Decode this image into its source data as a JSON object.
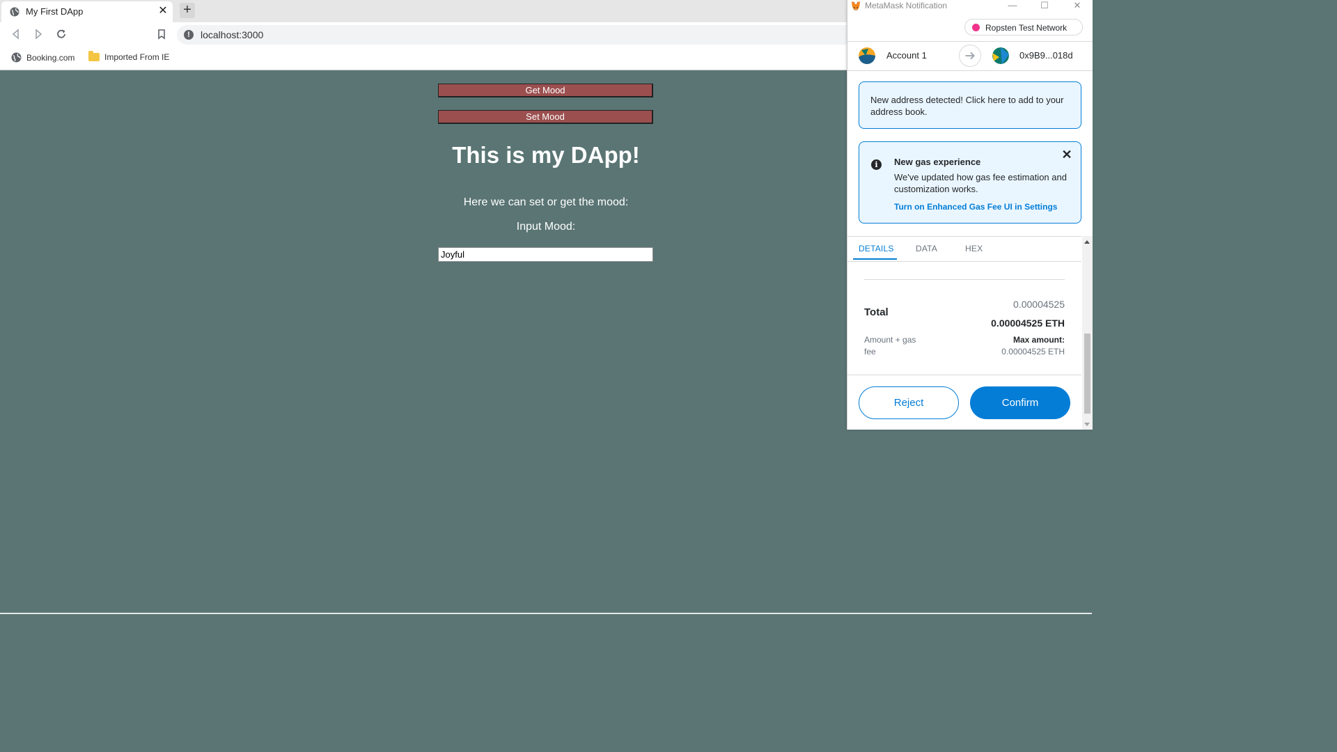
{
  "browser": {
    "tab_title": "My First DApp",
    "url": "localhost:3000",
    "bookmarks": [
      "Booking.com",
      "Imported From IE"
    ]
  },
  "dapp": {
    "get_mood_label": "Get Mood",
    "set_mood_label": "Set Mood",
    "title": "This is my DApp!",
    "subtitle": "Here we can set or get the mood:",
    "input_label": "Input Mood:",
    "input_value": "Joyful",
    "background_color": "#5a7574",
    "button_color": "#9b4f4f"
  },
  "metamask": {
    "window_title": "MetaMask Notification",
    "network": "Ropsten Test Network",
    "account_name": "Account 1",
    "recipient_address": "0x9B9...018d",
    "notice_text": "New address detected! Click here to add to your address book.",
    "gas_notice": {
      "title": "New gas experience",
      "body": "We've updated how gas fee estimation and customization works.",
      "link": "Turn on Enhanced Gas Fee UI in Settings"
    },
    "tabs": [
      "DETAILS",
      "DATA",
      "HEX"
    ],
    "active_tab": "DETAILS",
    "total": {
      "label": "Total",
      "value": "0.00004525",
      "value_eth": "0.00004525 ETH",
      "sub_label": "Amount + gas fee",
      "max_label": "Max amount:",
      "max_value": "0.00004525 ETH"
    },
    "reject_label": "Reject",
    "confirm_label": "Confirm",
    "accent_color": "#037dd6"
  }
}
